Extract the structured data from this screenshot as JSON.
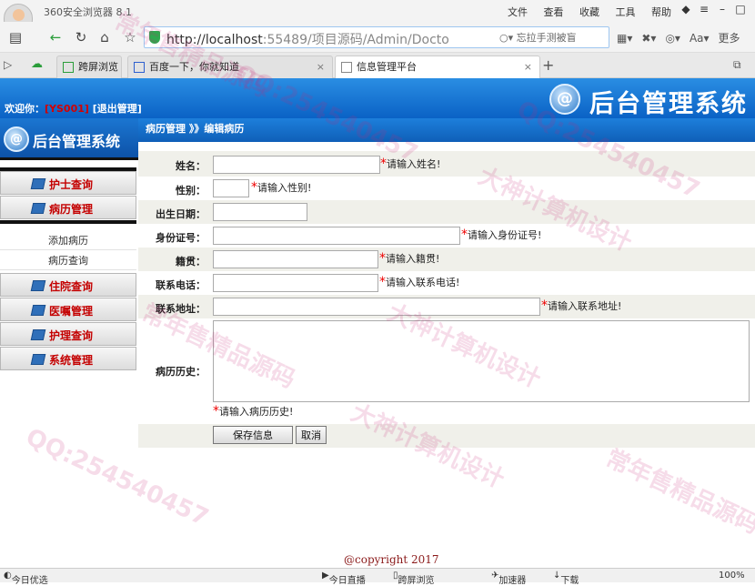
{
  "browser": {
    "app_title": "360安全浏览器 8.1",
    "menu": [
      "文件",
      "查看",
      "收藏",
      "工具",
      "帮助"
    ],
    "url_host": "http://localhost",
    "url_rest": ":55489/项目源码/Admin/Docto",
    "search_hint": "忘拉手测被盲",
    "addr_extra": "更多",
    "tabs": [
      {
        "label": "跨屏浏览"
      },
      {
        "label": "百度一下，你就知道"
      },
      {
        "label": "信息管理平台"
      }
    ],
    "status_left": "今日优选",
    "status_items": [
      "今日直播",
      "跨屏浏览",
      "加速器",
      "下载",
      "100%"
    ]
  },
  "header": {
    "system_title": "后台管理系统",
    "welcome_label": "欢迎你：",
    "username": "[YS001]",
    "logout": "[退出管理]"
  },
  "sidebar": {
    "logo_title": "后台管理系统",
    "items": [
      {
        "label": "护士查询"
      },
      {
        "label": "病历管理"
      },
      {
        "label": "住院查询"
      },
      {
        "label": "医嘱管理"
      },
      {
        "label": "护理查询"
      },
      {
        "label": "系统管理"
      }
    ],
    "sub_items": [
      {
        "label": "添加病历"
      },
      {
        "label": "病历查询"
      }
    ]
  },
  "breadcrumb": {
    "text": "病历管理 》》编辑病历"
  },
  "form": {
    "name": {
      "label": "姓名：",
      "value": "",
      "hint": "请输入姓名!"
    },
    "gender": {
      "label": "性别：",
      "value": "",
      "hint": "请输入性别!"
    },
    "birth": {
      "label": "出生日期：",
      "value": ""
    },
    "idcard": {
      "label": "身份证号：",
      "value": "",
      "hint": "请输入身份证号!"
    },
    "hometown": {
      "label": "籍贯：",
      "value": "",
      "hint": "请输入籍贯!"
    },
    "phone": {
      "label": "联系电话：",
      "value": "",
      "hint": "请输入联系电话!"
    },
    "address": {
      "label": "联系地址：",
      "value": "",
      "hint": "请输入联系地址!"
    },
    "history": {
      "label": "病历历史：",
      "value": "",
      "hint": "请输入病历历史!"
    },
    "save_label": "保存信息",
    "cancel_label": "取消"
  },
  "footer": {
    "copyright": "@copyright 2017"
  },
  "watermarks": [
    "常年售精品源码",
    "QQ:254540457",
    "大神计算机设计",
    "QQ:254540457",
    "常年售精品源码",
    "大神计算机设计",
    "QQ:254540457",
    "常年售精品源码",
    "大神计算机设计"
  ]
}
